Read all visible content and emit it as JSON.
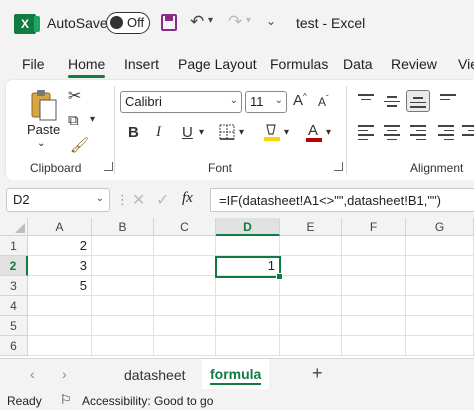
{
  "titlebar": {
    "app_letter": "X",
    "autosave_label": "AutoSave",
    "autosave_state": "Off",
    "doc_title": "test  -  Excel"
  },
  "tabs": [
    {
      "label": "File"
    },
    {
      "label": "Home",
      "active": true
    },
    {
      "label": "Insert"
    },
    {
      "label": "Page Layout"
    },
    {
      "label": "Formulas"
    },
    {
      "label": "Data"
    },
    {
      "label": "Review"
    },
    {
      "label": "View"
    }
  ],
  "ribbon": {
    "clipboard": {
      "paste_label": "Paste",
      "group_label": "Clipboard"
    },
    "font": {
      "font_name": "Calibri",
      "font_size": "11",
      "bold": "B",
      "italic": "I",
      "underline": "U",
      "grow": "A",
      "shrink": "A",
      "font_color_letter": "A",
      "group_label": "Font"
    },
    "alignment": {
      "group_label": "Alignment"
    }
  },
  "formula_bar": {
    "name_box": "D2",
    "fx": "fx",
    "formula": "=IF(datasheet!A1<>\"\",datasheet!B1,\"\")"
  },
  "grid": {
    "columns": [
      "A",
      "B",
      "C",
      "D",
      "E",
      "F",
      "G"
    ],
    "rows": [
      "1",
      "2",
      "3",
      "4",
      "5",
      "6"
    ],
    "selected_column": "D",
    "selected_row": "2",
    "cells": {
      "A1": "2",
      "A2": "3",
      "A3": "5",
      "D2": "1"
    }
  },
  "sheets": [
    {
      "label": "datasheet"
    },
    {
      "label": "formula",
      "active": true
    }
  ],
  "add_sheet": "+",
  "status": {
    "ready": "Ready",
    "accessibility": "Accessibility: Good to go"
  },
  "colors": {
    "accent": "#107c41",
    "save_icon": "#8a2a8a",
    "highlight": "#ffd400",
    "font_color": "#c00000"
  }
}
